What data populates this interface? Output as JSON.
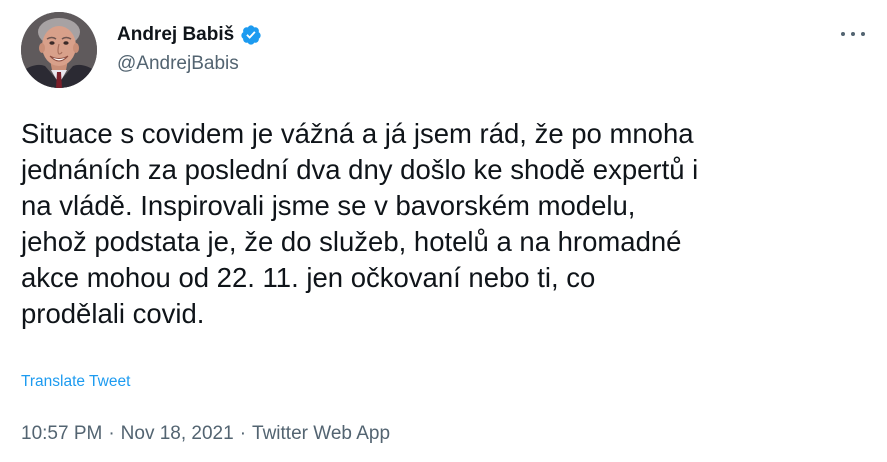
{
  "author": {
    "display_name": "Andrej Babiš",
    "handle": "@AndrejBabis",
    "verified_icon": "verified-badge-icon",
    "avatar_icon": "profile-photo"
  },
  "tweet": {
    "lines": [
      "Situace s covidem je vážná a já jsem rád, že po mnoha",
      "jednáních za poslední dva dny došlo ke shodě expertů i",
      "na vládě. Inspirovali jsme se v bavorském modelu,",
      "jehož podstata je, že do služeb, hotelů a na hromadné",
      "akce mohou od 22. 11. jen očkovaní nebo ti, co",
      "prodělali covid."
    ],
    "translate_label": "Translate Tweet"
  },
  "meta": {
    "time": "10:57 PM",
    "separator": "·",
    "date": "Nov 18, 2021",
    "source": "Twitter Web App"
  },
  "menu": {
    "more_icon": "more-options-icon"
  },
  "colors": {
    "text_primary": "#0f1419",
    "text_secondary": "#536471",
    "accent_blue": "#1d9bf0"
  }
}
